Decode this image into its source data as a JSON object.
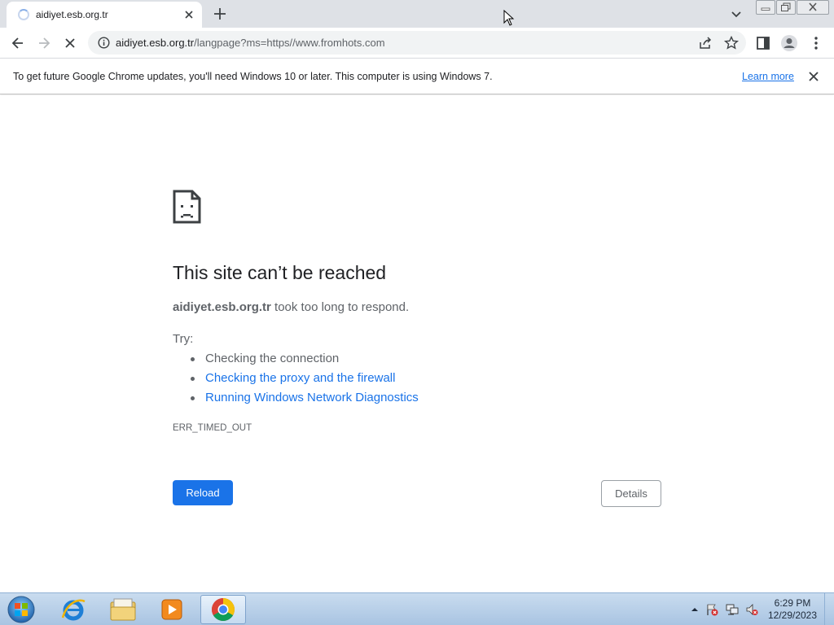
{
  "browser": {
    "tab": {
      "title": "aidiyet.esb.org.tr"
    },
    "address": {
      "host": "aidiyet.esb.org.tr",
      "path": "/langpage?ms=https//www.fromhots.com"
    }
  },
  "infobar": {
    "message": "To get future Google Chrome updates, you'll need Windows 10 or later. This computer is using Windows 7.",
    "link": "Learn more"
  },
  "error": {
    "title": "This site can’t be reached",
    "host": "aidiyet.esb.org.tr",
    "description_suffix": " took too long to respond.",
    "try_label": "Try:",
    "suggestions": [
      "Checking the connection",
      "Checking the proxy and the firewall",
      "Running Windows Network Diagnostics"
    ],
    "code": "ERR_TIMED_OUT",
    "reload_label": "Reload",
    "details_label": "Details"
  },
  "taskbar": {
    "time": "6:29 PM",
    "date": "12/29/2023"
  },
  "colors": {
    "accent": "#1a73e8",
    "text_primary": "#202124",
    "text_secondary": "#5f6368"
  }
}
